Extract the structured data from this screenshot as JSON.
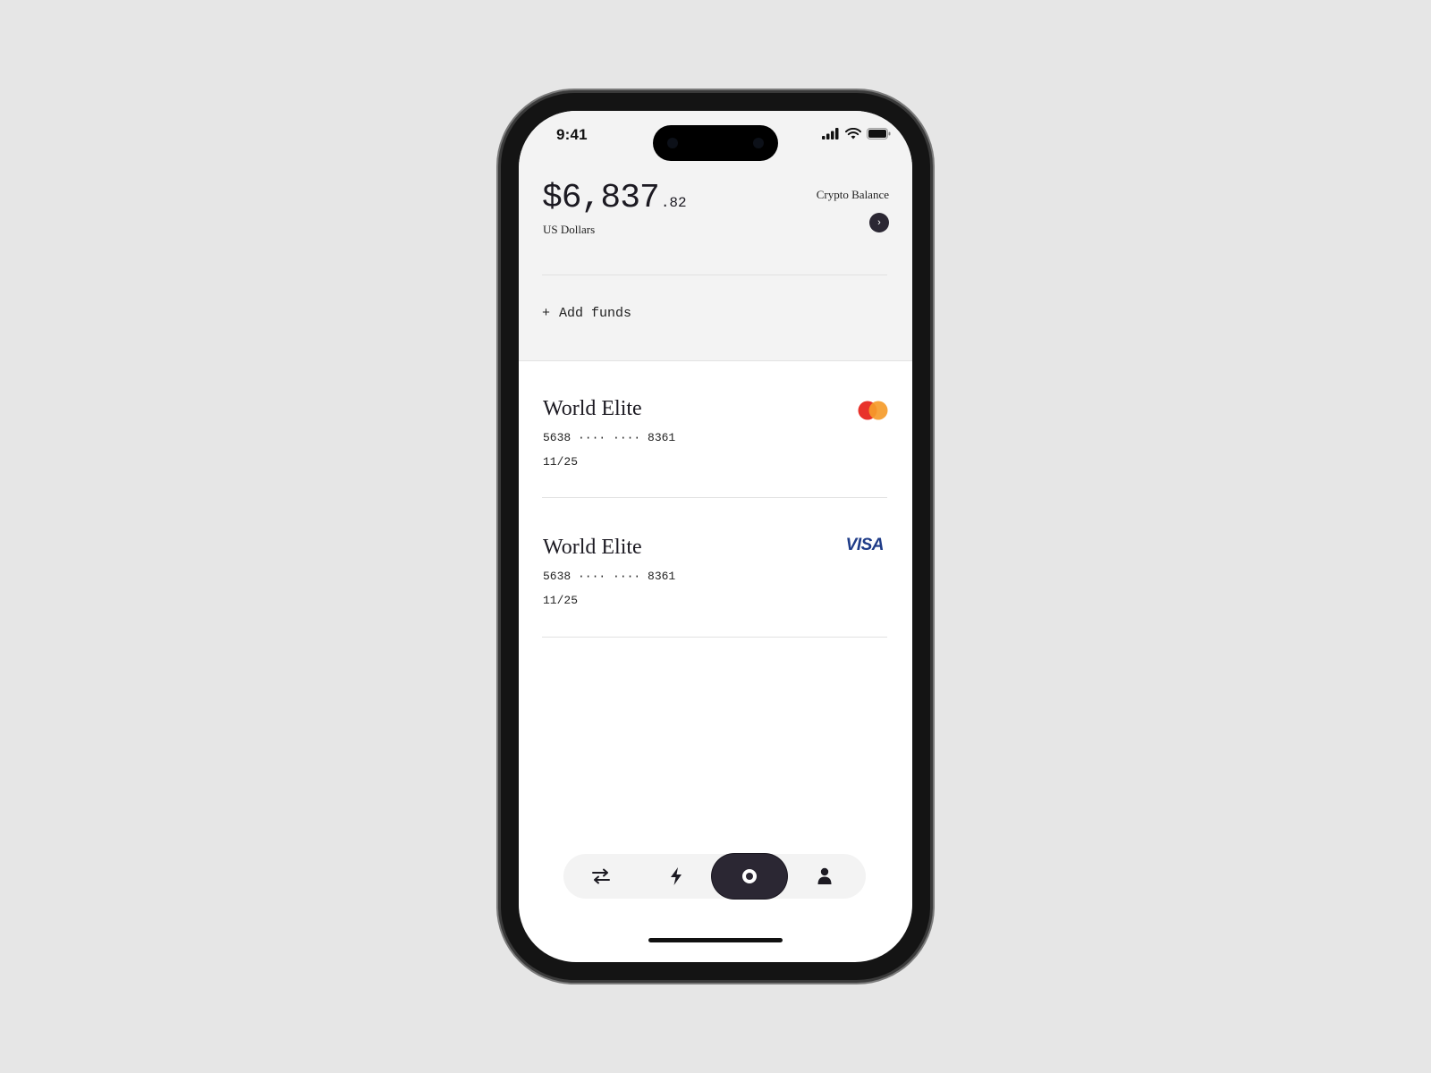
{
  "status_bar": {
    "time": "9:41"
  },
  "balance": {
    "amount_main": "$6,837",
    "amount_cents": ".82",
    "currency_label": "US Dollars",
    "crypto_label": "Crypto Balance",
    "crypto_arrow": "›"
  },
  "actions": {
    "add_funds_plus": "+",
    "add_funds_label": "Add funds"
  },
  "cards": [
    {
      "name": "World Elite",
      "number": "5638 ···· ···· 8361",
      "expiry": "11/25",
      "network_icon": "mastercard-logo"
    },
    {
      "name": "World Elite",
      "number": "5638 ···· ···· 8361",
      "expiry": "11/25",
      "network_icon": "visa-logo",
      "network_text": "VISA"
    }
  ],
  "nav": {
    "items": [
      {
        "icon": "transfer-arrows-icon",
        "active": false
      },
      {
        "icon": "lightning-bolt-icon",
        "active": false
      },
      {
        "icon": "cards-circle-icon",
        "active": true
      },
      {
        "icon": "person-icon",
        "active": false
      }
    ]
  },
  "colors": {
    "accent_dark": "#2b2733",
    "visa_blue": "#1f3c88",
    "mastercard_red": "#e8322b",
    "mastercard_orange": "#f59b2a"
  }
}
